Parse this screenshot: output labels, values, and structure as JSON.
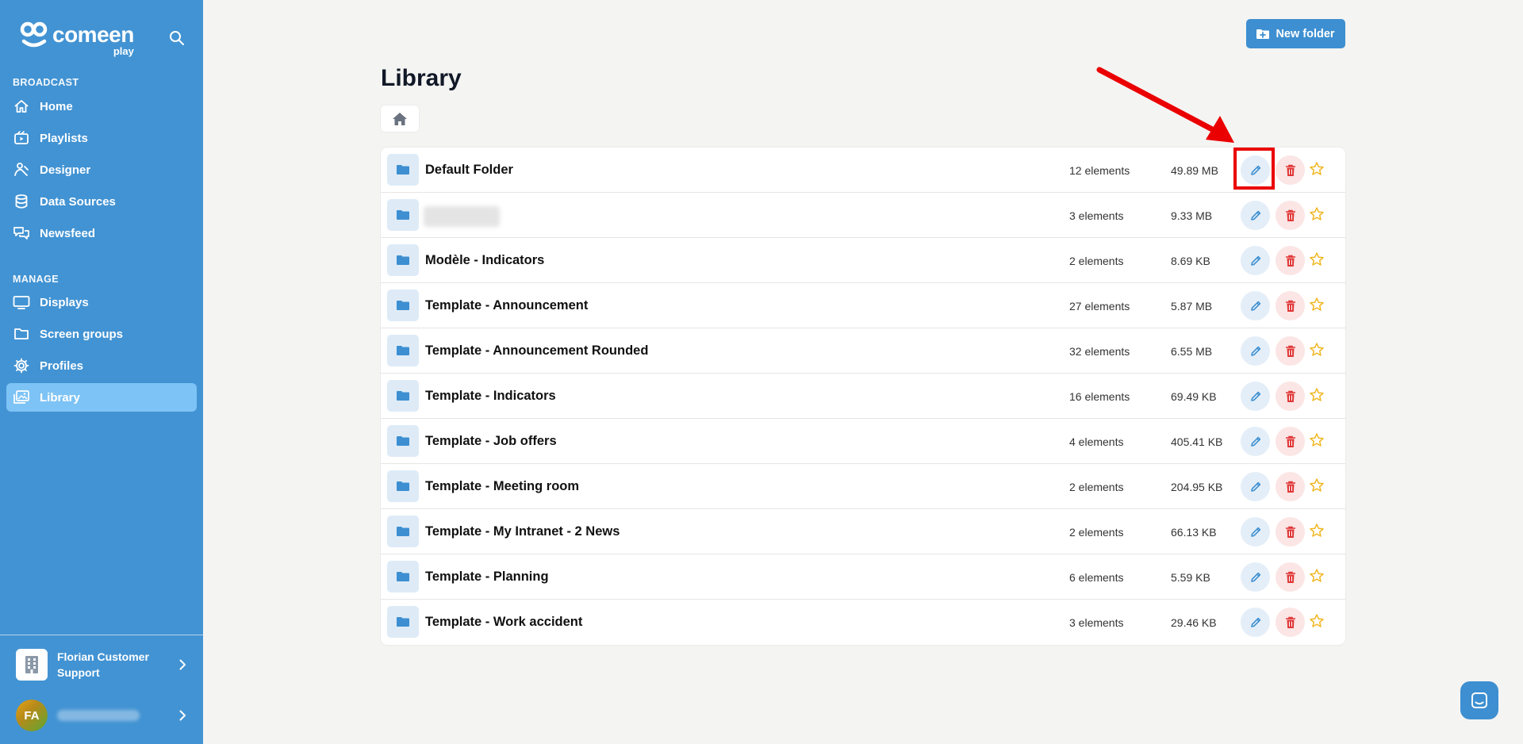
{
  "brand": {
    "name": "comeen",
    "sub": "play"
  },
  "sidebar": {
    "sections": [
      {
        "label": "BROADCAST",
        "items": [
          {
            "label": "Home",
            "icon": "home-icon"
          },
          {
            "label": "Playlists",
            "icon": "playlist-icon"
          },
          {
            "label": "Designer",
            "icon": "designer-icon"
          },
          {
            "label": "Data Sources",
            "icon": "database-icon"
          },
          {
            "label": "Newsfeed",
            "icon": "chat-bubbles-icon"
          }
        ]
      },
      {
        "label": "MANAGE",
        "items": [
          {
            "label": "Displays",
            "icon": "monitor-icon"
          },
          {
            "label": "Screen groups",
            "icon": "folder-outline-icon"
          },
          {
            "label": "Profiles",
            "icon": "gear-icon"
          },
          {
            "label": "Library",
            "icon": "images-icon",
            "active": true
          }
        ]
      }
    ],
    "organization": {
      "name": "Florian Customer Support"
    },
    "user": {
      "initials": "FA"
    }
  },
  "header": {
    "new_folder_label": "New folder"
  },
  "page": {
    "title": "Library"
  },
  "folders": [
    {
      "name": "Default Folder",
      "count": "12 elements",
      "size": "49.89 MB"
    },
    {
      "name": "",
      "count": "3 elements",
      "size": "9.33 MB",
      "redacted": true
    },
    {
      "name": "Modèle - Indicators",
      "count": "2 elements",
      "size": "8.69 KB"
    },
    {
      "name": "Template - Announcement",
      "count": "27 elements",
      "size": "5.87 MB"
    },
    {
      "name": "Template - Announcement Rounded",
      "count": "32 elements",
      "size": "6.55 MB"
    },
    {
      "name": "Template - Indicators",
      "count": "16 elements",
      "size": "69.49 KB"
    },
    {
      "name": "Template - Job offers",
      "count": "4 elements",
      "size": "405.41 KB"
    },
    {
      "name": "Template - Meeting room",
      "count": "2 elements",
      "size": "204.95 KB"
    },
    {
      "name": "Template - My Intranet - 2 News",
      "count": "2 elements",
      "size": "66.13 KB"
    },
    {
      "name": "Template - Planning",
      "count": "6 elements",
      "size": "5.59 KB"
    },
    {
      "name": "Template - Work accident",
      "count": "3 elements",
      "size": "29.46 KB"
    }
  ],
  "colors": {
    "sidebar": "#4293d3",
    "sidebar_active": "#7dc3f5",
    "primary_button": "#3d8fd1",
    "edit": "#3d8fd1",
    "delete": "#e03535",
    "star": "#f1b722",
    "annotation": "#ea0000"
  }
}
